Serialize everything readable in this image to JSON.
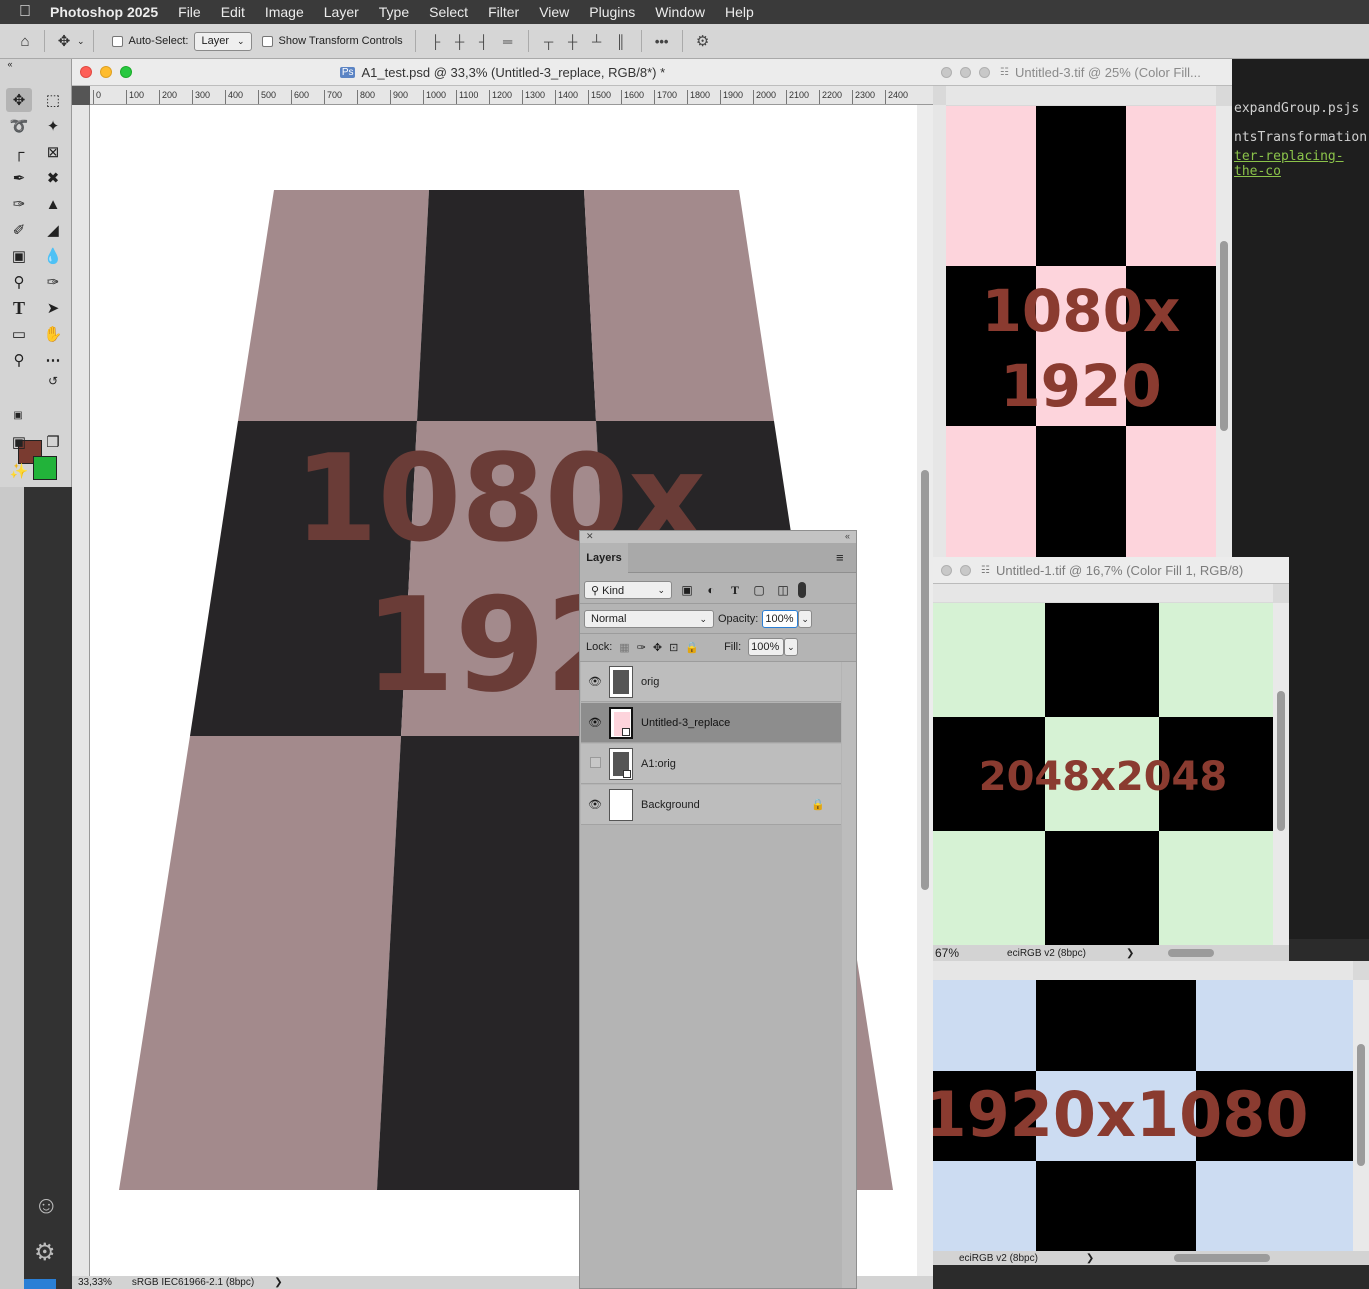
{
  "menubar": {
    "app_name": "Photoshop 2025",
    "items": [
      "File",
      "Edit",
      "Image",
      "Layer",
      "Type",
      "Select",
      "Filter",
      "View",
      "Plugins",
      "Window",
      "Help"
    ]
  },
  "options_bar": {
    "auto_select_label": "Auto-Select:",
    "auto_select_target": "Layer",
    "show_transform_label": "Show Transform Controls",
    "more_label": "•••"
  },
  "main_document": {
    "title": "A1_test.psd @ 33,3% (Untitled-3_replace, RGB/8*) *",
    "ruler_ticks": [
      "0",
      "100",
      "200",
      "300",
      "400",
      "500",
      "600",
      "700",
      "800",
      "900",
      "1000",
      "1100",
      "1200",
      "1300",
      "1400",
      "1500",
      "1600",
      "1700",
      "1800",
      "1900",
      "2000",
      "2100",
      "2200",
      "2300",
      "2400"
    ],
    "canvas_text_line1": "1080x",
    "canvas_text_line2": "192",
    "zoom": "33,33%",
    "profile": "sRGB IEC61966-2.1 (8bpc)",
    "status_arrow": "❯",
    "colors": {
      "pink": "#a38a8c",
      "dark": "#272527",
      "text": "#6a3c37"
    }
  },
  "tools": {
    "foreground_color": "#7a3b30",
    "background_color": "#22b33a"
  },
  "window_untitled3": {
    "title": "Untitled-3.tif @ 25% (Color Fill...",
    "text_line1": "1080x",
    "text_line2": "1920",
    "colors": {
      "light": "#fdd4dc",
      "dark": "#000000"
    }
  },
  "window_untitled1": {
    "title": "Untitled-1.tif @ 16,7% (Color Fill 1, RGB/8)",
    "text": "2048x2048",
    "zoom": "67%",
    "profile": "eciRGB v2 (8bpc)",
    "status_arrow": "❯",
    "colors": {
      "light": "#d6f2d4",
      "dark": "#000000"
    }
  },
  "window_blue": {
    "text": "1920x1080",
    "profile": "eciRGB v2 (8bpc)",
    "status_arrow": "❯",
    "colors": {
      "light": "#ccdcf2",
      "dark": "#000000"
    }
  },
  "editor": {
    "lines": [
      "expandGroup.psjs",
      "ntsTransformation.jsx",
      "ter-replacing-the-co"
    ]
  },
  "layers_panel": {
    "tab": "Layers",
    "filter_kind": "Kind",
    "blend_mode": "Normal",
    "opacity_label": "Opacity:",
    "opacity_value": "100%",
    "lock_label": "Lock:",
    "fill_label": "Fill:",
    "fill_value": "100%",
    "layers": [
      {
        "name": "orig",
        "visible": true,
        "selected": false
      },
      {
        "name": "Untitled-3_replace",
        "visible": true,
        "selected": true
      },
      {
        "name": "A1:orig",
        "visible": false,
        "selected": false
      },
      {
        "name": "Background",
        "visible": true,
        "selected": false,
        "locked": true
      }
    ]
  }
}
